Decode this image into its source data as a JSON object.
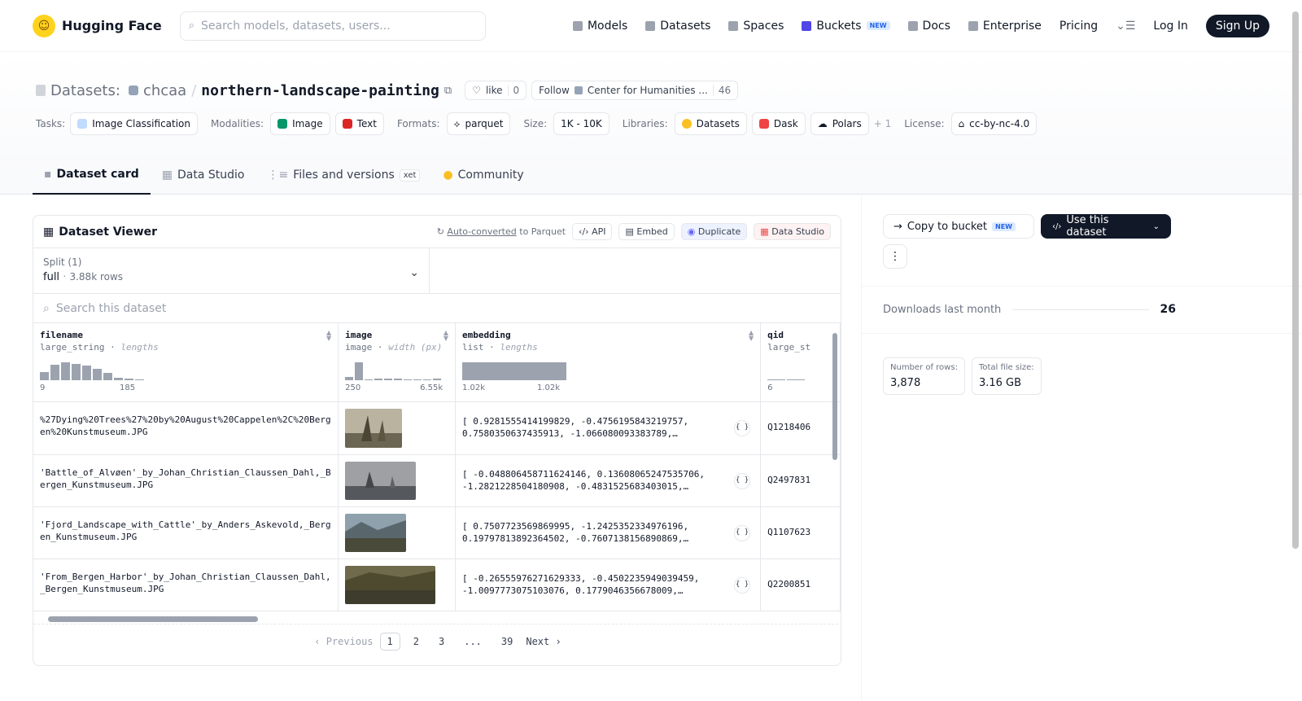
{
  "nav": {
    "brand": "Hugging Face",
    "search_placeholder": "Search models, datasets, users...",
    "links": [
      {
        "label": "Models",
        "icon": "models-icon"
      },
      {
        "label": "Datasets",
        "icon": "datasets-icon"
      },
      {
        "label": "Spaces",
        "icon": "spaces-icon"
      },
      {
        "label": "Buckets",
        "icon": "buckets-icon",
        "badge": "NEW"
      },
      {
        "label": "Docs",
        "icon": "docs-icon"
      },
      {
        "label": "Enterprise",
        "icon": "enterprise-icon"
      },
      {
        "label": "Pricing"
      }
    ],
    "login": "Log In",
    "signup": "Sign Up"
  },
  "header": {
    "section": "Datasets:",
    "owner": "chcaa",
    "sep": "/",
    "name": "northern-landscape-painting",
    "like_label": "like",
    "like_count": "0",
    "follow_label": "Follow",
    "follow_org": "Center for Humanities ...",
    "follow_count": "46",
    "tasks_label": "Tasks:",
    "task": "Image Classification",
    "modalities_label": "Modalities:",
    "modalities": [
      "Image",
      "Text"
    ],
    "formats_label": "Formats:",
    "format": "parquet",
    "size_label": "Size:",
    "size": "1K - 10K",
    "libraries_label": "Libraries:",
    "libraries": [
      "Datasets",
      "Dask",
      "Polars"
    ],
    "libraries_more": "+ 1",
    "license_label": "License:",
    "license": "cc-by-nc-4.0"
  },
  "tabs": [
    {
      "label": "Dataset card",
      "active": true
    },
    {
      "label": "Data Studio"
    },
    {
      "label": "Files and versions",
      "badge": "xet"
    },
    {
      "label": "Community"
    }
  ],
  "viewer": {
    "title": "Dataset Viewer",
    "converted": "Auto-converted",
    "converted_suffix": "to Parquet",
    "api": "API",
    "embed": "Embed",
    "duplicate": "Duplicate",
    "studio": "Data Studio",
    "split_label": "Split (1)",
    "split_value": "full",
    "split_rows": "3.88k rows",
    "search_placeholder": "Search this dataset",
    "columns": [
      {
        "name": "filename",
        "type": "large_string",
        "stat": "lengths",
        "min": "9",
        "max": "185",
        "hist": [
          0.45,
          0.85,
          1.0,
          0.9,
          0.8,
          0.65,
          0.4,
          0.15,
          0.08,
          0.06
        ]
      },
      {
        "name": "image",
        "type": "image",
        "stat": "width (px)",
        "min": "250",
        "max": "6.55k",
        "hist": [
          0.2,
          1.0,
          0.0,
          0.08,
          0.08,
          0.08,
          0.0,
          0.0,
          0.0,
          0.08
        ]
      },
      {
        "name": "embedding",
        "type": "list",
        "stat": "lengths",
        "min": "1.02k",
        "max": "1.02k",
        "hist": [
          1.0
        ]
      },
      {
        "name": "qid",
        "type": "large_st",
        "stat": "",
        "min": "6",
        "max": "",
        "hist": [
          0.06,
          0.06
        ]
      }
    ],
    "rows": [
      {
        "filename": "%27Dying%20Trees%27%20by%20August%20Cappelen%2C%20Bergen%20Kunstmuseum.JPG",
        "embedding": "[ 0.9281555414199829, -0.4756195843219757, 0.7580350637435913, -1.066080093383789,…",
        "qid": "Q1218406"
      },
      {
        "filename": "'Battle_of_Alvøen'_by_Johan_Christian_Claussen_Dahl,_Bergen_Kunstmuseum.JPG",
        "embedding": "[ -0.048806458711624146, 0.13608065247535706, -1.2821228504180908, -0.4831525683403015,…",
        "qid": "Q2497831"
      },
      {
        "filename": "'Fjord_Landscape_with_Cattle'_by_Anders_Askevold,_Bergen_Kunstmuseum.JPG",
        "embedding": "[ 0.7507723569869995, -1.2425352334976196, 0.19797813892364502, -0.7607138156890869,…",
        "qid": "Q1107623"
      },
      {
        "filename": "'From_Bergen_Harbor'_by_Johan_Christian_Claussen_Dahl,_Bergen_Kunstmuseum.JPG",
        "embedding": "[ -0.26555976271629333, -0.4502235949039459, -1.0097773075103076, 0.1779046356678009,…",
        "qid": "Q2200851"
      }
    ],
    "pager": {
      "prev": "Previous",
      "pages": [
        "1",
        "2",
        "3",
        "...",
        "39"
      ],
      "current": "1",
      "next": "Next"
    }
  },
  "sidebar": {
    "copy_bucket": "Copy to bucket",
    "copy_badge": "NEW",
    "use_dataset": "Use this dataset",
    "downloads_label": "Downloads last month",
    "downloads": "26",
    "rows_label": "Number of rows:",
    "rows": "3,878",
    "size_label": "Total file size:",
    "size": "3.16 GB"
  }
}
